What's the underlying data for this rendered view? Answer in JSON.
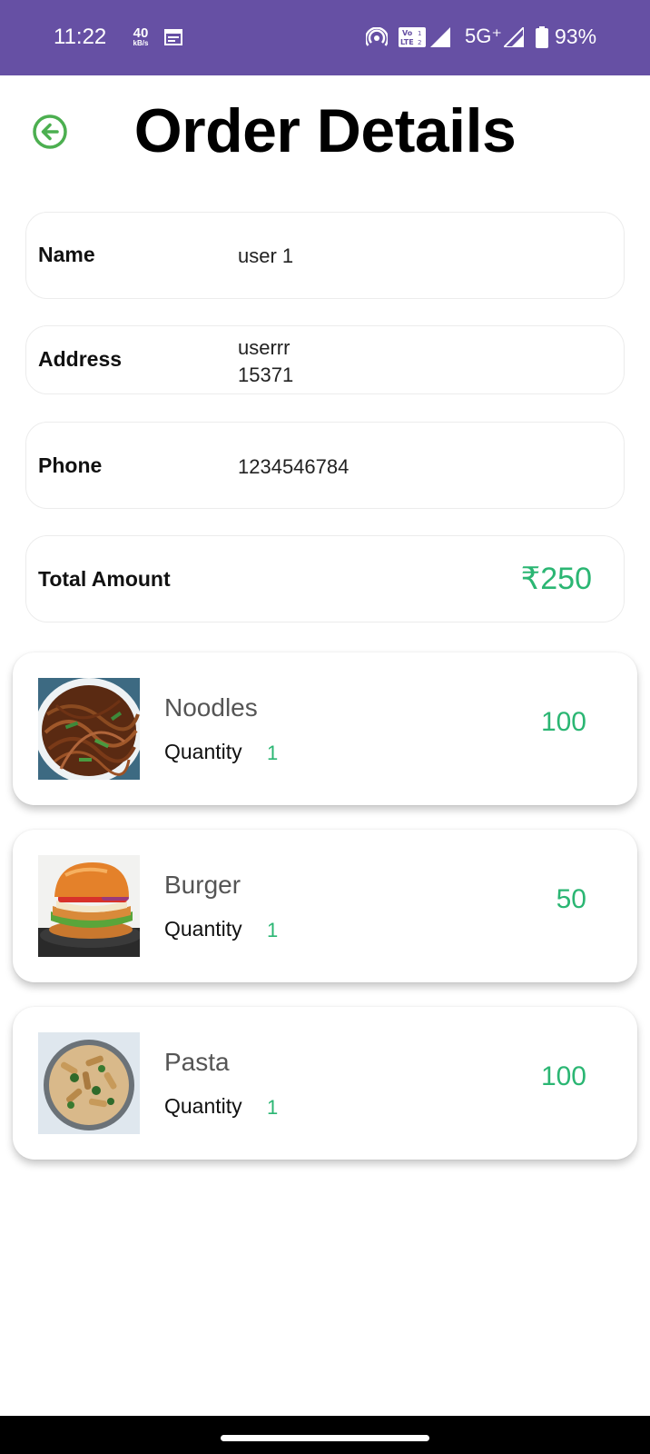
{
  "status_bar": {
    "time": "11:22",
    "data_speed": "40",
    "data_speed_unit": "kB/s",
    "volte": "Vo LTE 1 2",
    "network": "5G⁺",
    "battery": "93%",
    "background_color": "#6650a4"
  },
  "header": {
    "title": "Order Details",
    "back_icon": "arrow-left-circle-icon",
    "accent_color": "#4caf50"
  },
  "details": {
    "name": {
      "label": "Name",
      "value": "user 1"
    },
    "address": {
      "label": "Address",
      "line1": "userrr",
      "line2": "15371"
    },
    "phone": {
      "label": "Phone",
      "value": "1234546784"
    },
    "total": {
      "label": "Total Amount",
      "value": "₹250"
    }
  },
  "items": [
    {
      "name": "Noodles",
      "quantity_label": "Quantity",
      "quantity": "1",
      "price": "100",
      "image": "noodles-image"
    },
    {
      "name": "Burger",
      "quantity_label": "Quantity",
      "quantity": "1",
      "price": "50",
      "image": "burger-image"
    },
    {
      "name": "Pasta",
      "quantity_label": "Quantity",
      "quantity": "1",
      "price": "100",
      "image": "pasta-image"
    }
  ],
  "colors": {
    "price_green": "#2bb673"
  }
}
